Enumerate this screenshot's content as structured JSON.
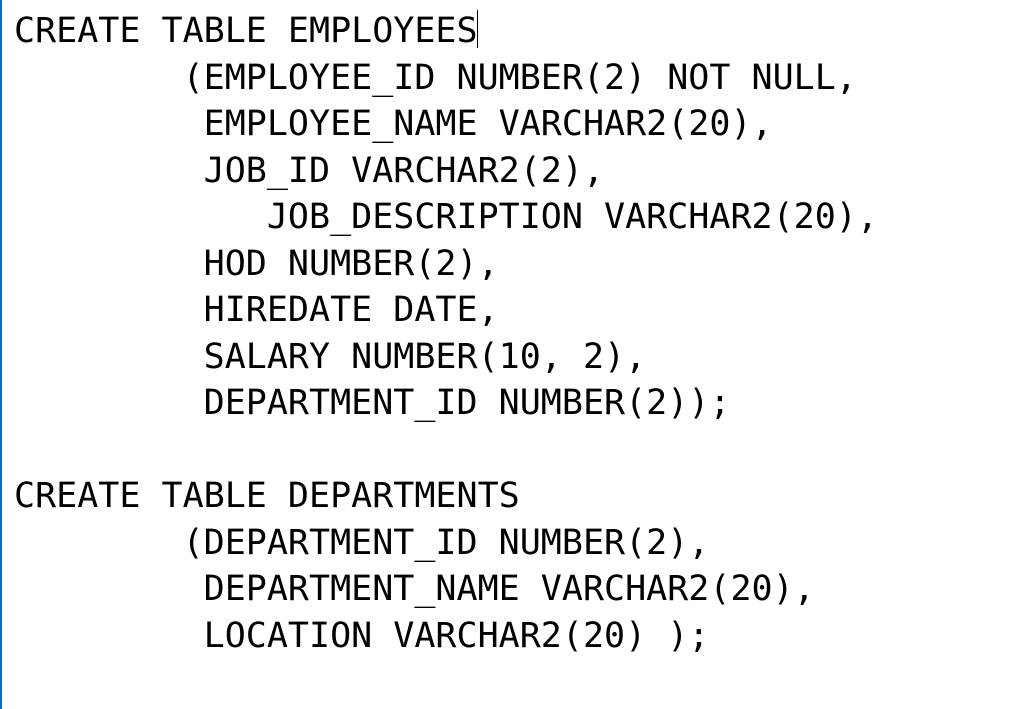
{
  "code": {
    "lines": [
      "CREATE TABLE EMPLOYEES",
      "        (EMPLOYEE_ID NUMBER(2) NOT NULL,",
      "         EMPLOYEE_NAME VARCHAR2(20),",
      "         JOB_ID VARCHAR2(2),",
      "            JOB_DESCRIPTION VARCHAR2(20),",
      "         HOD NUMBER(2),",
      "         HIREDATE DATE,",
      "         SALARY NUMBER(10, 2),",
      "         DEPARTMENT_ID NUMBER(2));",
      "",
      "CREATE TABLE DEPARTMENTS",
      "        (DEPARTMENT_ID NUMBER(2),",
      "         DEPARTMENT_NAME VARCHAR2(20),",
      "         LOCATION VARCHAR2(20) );"
    ],
    "cursor_line_index": 0
  }
}
